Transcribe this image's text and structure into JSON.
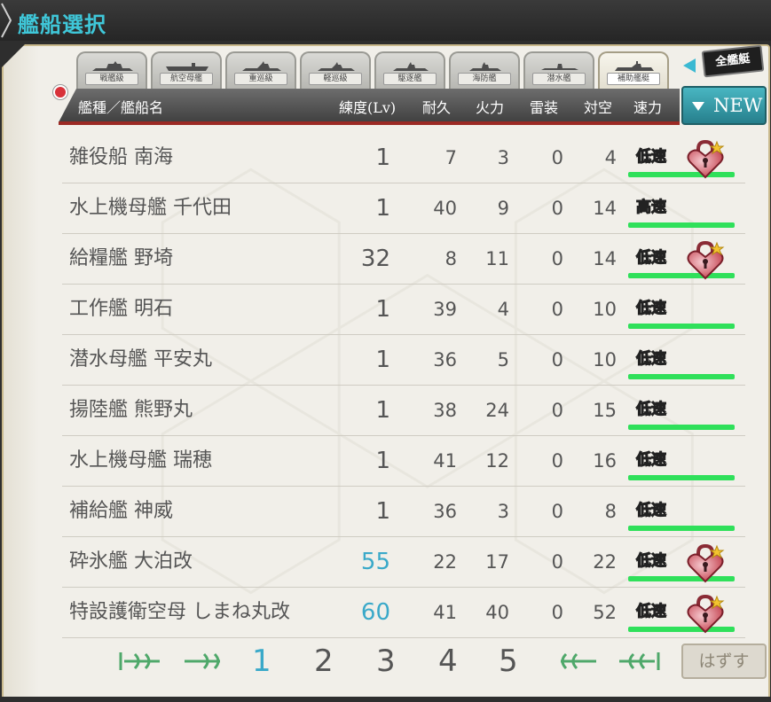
{
  "title": "艦船選択",
  "tabs": [
    "戦艦級",
    "航空母艦",
    "重巡級",
    "軽巡級",
    "駆逐艦",
    "海防艦",
    "潜水艦",
    "補助艦艇"
  ],
  "active_tab_index": 7,
  "all_ships_label": "全艦艇",
  "header": {
    "type_name": "艦種／艦船名",
    "level": "練度(Lv)",
    "hp": "耐久",
    "firepower": "火力",
    "torpedo": "雷装",
    "aa": "対空",
    "speed": "速力"
  },
  "new_button_label": "NEW",
  "rows": [
    {
      "name": "雑役船 南海",
      "level": "1",
      "hp": "7",
      "firepower": "3",
      "torpedo": "0",
      "aa": "4",
      "speed": "低速",
      "locked": true
    },
    {
      "name": "水上機母艦 千代田",
      "level": "1",
      "hp": "40",
      "firepower": "9",
      "torpedo": "0",
      "aa": "14",
      "speed": "高速",
      "locked": false
    },
    {
      "name": "給糧艦 野埼",
      "level": "32",
      "hp": "8",
      "firepower": "11",
      "torpedo": "0",
      "aa": "14",
      "speed": "低速",
      "locked": true
    },
    {
      "name": "工作艦 明石",
      "level": "1",
      "hp": "39",
      "firepower": "4",
      "torpedo": "0",
      "aa": "10",
      "speed": "低速",
      "locked": false
    },
    {
      "name": "潜水母艦 平安丸",
      "level": "1",
      "hp": "36",
      "firepower": "5",
      "torpedo": "0",
      "aa": "10",
      "speed": "低速",
      "locked": false
    },
    {
      "name": "揚陸艦 熊野丸",
      "level": "1",
      "hp": "38",
      "firepower": "24",
      "torpedo": "0",
      "aa": "15",
      "speed": "低速",
      "locked": false
    },
    {
      "name": "水上機母艦 瑞穂",
      "level": "1",
      "hp": "41",
      "firepower": "12",
      "torpedo": "0",
      "aa": "16",
      "speed": "低速",
      "locked": false
    },
    {
      "name": "補給艦 神威",
      "level": "1",
      "hp": "36",
      "firepower": "3",
      "torpedo": "0",
      "aa": "8",
      "speed": "低速",
      "locked": false
    },
    {
      "name": "砕氷艦 大泊改",
      "level": "55",
      "hp": "22",
      "firepower": "17",
      "torpedo": "0",
      "aa": "22",
      "speed": "低速",
      "locked": true
    },
    {
      "name": "特設護衛空母 しまね丸改",
      "level": "60",
      "hp": "41",
      "firepower": "40",
      "torpedo": "0",
      "aa": "52",
      "speed": "低速",
      "locked": true
    }
  ],
  "pagination": {
    "pages": [
      "1",
      "2",
      "3",
      "4",
      "5"
    ],
    "current": "1"
  },
  "remove_button_label": "はずす",
  "colors": {
    "accent": "#3aa9c9",
    "speed_bar": "#2fe05a",
    "title": "#3fc7d9",
    "header_line": "#9b2a24"
  }
}
